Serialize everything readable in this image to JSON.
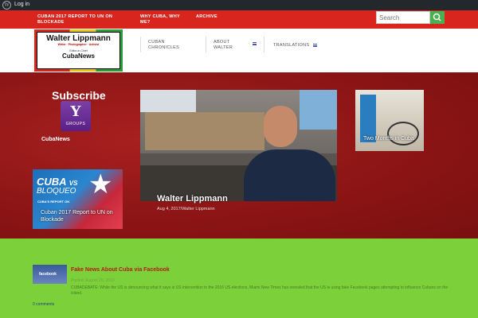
{
  "admin_bar": {
    "wp_icon": "wordpress-icon",
    "login": "Log in"
  },
  "top_nav": [
    {
      "label": "CUBAN 2017 REPORT TO UN ON BLOCKADE"
    },
    {
      "label": "WHY CUBA, WHY ME?"
    },
    {
      "label": "ARCHIVE"
    }
  ],
  "search": {
    "placeholder": "Search",
    "icon": "search-icon"
  },
  "logo": {
    "name": "Walter Lippmann",
    "tagline": "Writer · Photographer · Activist",
    "editor": "Editor-in-Chief",
    "brand": "CubaNews"
  },
  "main_nav": [
    {
      "label": "CUBAN CHRONICLES"
    },
    {
      "label": "ABOUT WALTER"
    },
    {
      "label": "TRANSLATIONS"
    }
  ],
  "sidebar": {
    "subscribe": "Subscribe",
    "ygroups_letter": "Y",
    "ygroups_label": "GROUPS",
    "cubanews": "CubaNews"
  },
  "bloqueo": {
    "h1": "CUBA",
    "vs": "VS",
    "h2": "BLOQUEO",
    "sub": "CUBA'S REPORT ON",
    "caption": "Cuban 2017 Report to UN on Blockade"
  },
  "featured": {
    "title": "Walter Lippmann",
    "meta": "Aug 4, 2017/Walter Lippmann"
  },
  "side_post": {
    "caption": "Two Months in Cuba"
  },
  "post": {
    "thumb_label": "facebook",
    "title": "Fake News About Cuba via Facebook",
    "meta": "Posted: August 20, 2019",
    "excerpt": "CUBADEBATE: While the US is denouncing what it says is US intervention in the 2016 US elections, Miami New Times has revealed that the US is using fake Facebook pages attempting to influence Cubans on the island.",
    "comments": "0 comments"
  },
  "colors": {
    "red": "#d8261e",
    "dark_red": "#8e1515",
    "green": "#7cd13a",
    "adminbar": "#23282d",
    "accent_blue": "#4a56b8"
  }
}
